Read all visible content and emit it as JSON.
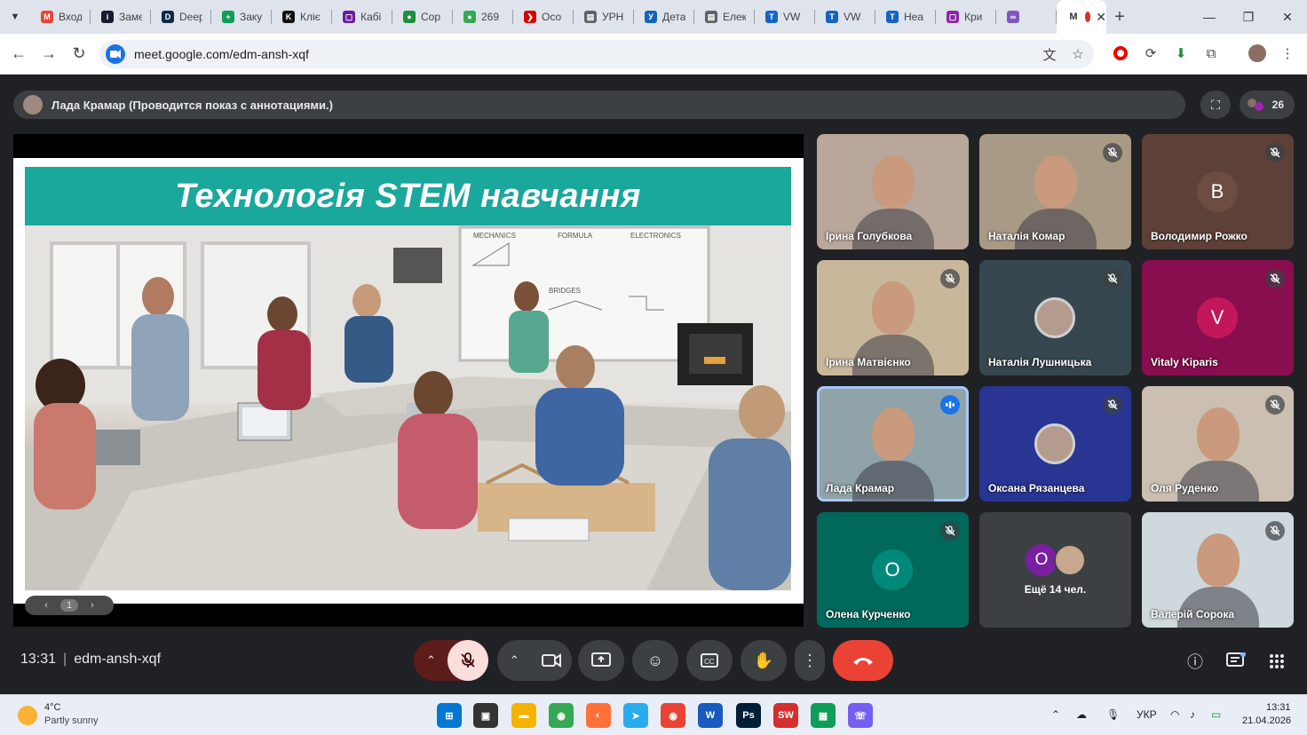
{
  "browser": {
    "tabs": [
      {
        "title": "Вход",
        "icon": "gmail-icon",
        "color": "#ea4335",
        "glyph": "M"
      },
      {
        "title": "Замет",
        "icon": "info-icon",
        "color": "#1a1a2e",
        "glyph": "i"
      },
      {
        "title": "DeepL",
        "icon": "deepl-icon",
        "color": "#0f2b46",
        "glyph": "D"
      },
      {
        "title": "Закупки",
        "icon": "sheets-icon",
        "color": "#0f9d58",
        "glyph": "+"
      },
      {
        "title": "Кліє",
        "icon": "k-icon",
        "color": "#111111",
        "glyph": "K"
      },
      {
        "title": "Кабі",
        "icon": "square-icon",
        "color": "#6a1b9a",
        "glyph": "▢"
      },
      {
        "title": "Сор",
        "icon": "green-circle-icon",
        "color": "#1e8e3e",
        "glyph": "●"
      },
      {
        "title": "269",
        "icon": "green-circle-icon",
        "color": "#34a853",
        "glyph": "●"
      },
      {
        "title": "Осо",
        "icon": "chevron-icon",
        "color": "#d50000",
        "glyph": "❯"
      },
      {
        "title": "УРН",
        "icon": "doc-icon",
        "color": "#5f6368",
        "glyph": "▤"
      },
      {
        "title": "Дета",
        "icon": "y-icon",
        "color": "#1565c0",
        "glyph": "У"
      },
      {
        "title": "Елек",
        "icon": "doc-icon",
        "color": "#5f6368",
        "glyph": "▤"
      },
      {
        "title": "VW",
        "icon": "t-icon",
        "color": "#1565c0",
        "glyph": "T"
      },
      {
        "title": "VW",
        "icon": "t-icon",
        "color": "#1565c0",
        "glyph": "T"
      },
      {
        "title": "Неа",
        "icon": "t-icon",
        "color": "#1565c0",
        "glyph": "T"
      },
      {
        "title": "Кри",
        "icon": "square-icon",
        "color": "#8e24aa",
        "glyph": "▢"
      },
      {
        "title": "",
        "icon": "crochet-icon",
        "color": "#7e57c2",
        "glyph": "∞"
      }
    ],
    "active_tab": {
      "title": "M",
      "icon": "record-icon"
    },
    "new_tab": "+",
    "url": "meet.google.com/edm-ansh-xqf"
  },
  "meet": {
    "presenter_label": "Лада Крамар (Проводится показ с аннотациями.)",
    "people_count": "26",
    "slide": {
      "title": "Технологія STEM навчання",
      "page": "1",
      "board": {
        "mechanics": "MECHANICS",
        "formula": "FORMULA",
        "electronics": "ELECTRONICS",
        "bridges": "BRIDGES"
      }
    },
    "participants": [
      {
        "name": "Ірина Голубкова",
        "type": "video",
        "muted": false,
        "bg": "#b8a79a"
      },
      {
        "name": "Наталія Комар",
        "type": "video",
        "muted": true,
        "bg": "#a99a86"
      },
      {
        "name": "Володимир Рожко",
        "type": "avatar",
        "initial": "B",
        "avatar_color": "#6d4c41",
        "muted": true,
        "bg": "#5d4037"
      },
      {
        "name": "Ірина Матвієнко",
        "type": "video",
        "muted": true,
        "bg": "#c9b79c"
      },
      {
        "name": "Наталія Лушницька",
        "type": "photo",
        "muted": true,
        "bg": "#37474f"
      },
      {
        "name": "Vitaly Kiparis",
        "type": "avatar",
        "initial": "V",
        "avatar_color": "#c2185b",
        "muted": true,
        "bg": "#880e4f"
      },
      {
        "name": "Лада Крамар",
        "type": "video",
        "muted": false,
        "speaking": true,
        "bg": "#8fa3a8"
      },
      {
        "name": "Оксана Рязанцева",
        "type": "photo",
        "muted": true,
        "bg": "#283593"
      },
      {
        "name": "Оля Руденко",
        "type": "video",
        "muted": true,
        "bg": "#cbbfb2"
      },
      {
        "name": "Олена Курченко",
        "type": "avatar",
        "initial": "O",
        "avatar_color": "#00897b",
        "muted": true,
        "bg": "#00695c"
      },
      {
        "name": "Ещё 14 чел.",
        "type": "more",
        "initial": "O",
        "avatar_color": "#7b1fa2",
        "muted": false,
        "bg": "#3c4043"
      },
      {
        "name": "Валерій Сорока",
        "type": "video",
        "muted": true,
        "bg": "#cfd8dc"
      }
    ],
    "clock": "13:31",
    "meeting_code": "edm-ansh-xqf"
  },
  "taskbar": {
    "weather_temp": "4°C",
    "weather_desc": "Partly sunny",
    "language": "УКР",
    "time": "13:31",
    "date": "21.04.2026",
    "apps": [
      {
        "name": "start-button",
        "glyph": "⊞",
        "color": "#0078d4"
      },
      {
        "name": "task-view-icon",
        "glyph": "▣",
        "color": "#333333"
      },
      {
        "name": "file-explorer-icon",
        "glyph": "▬",
        "color": "#f4b400"
      },
      {
        "name": "chrome-icon",
        "glyph": "◉",
        "color": "#34a853"
      },
      {
        "name": "firefox-icon",
        "glyph": "◐",
        "color": "#ff7139"
      },
      {
        "name": "telegram-icon",
        "glyph": "➤",
        "color": "#2aabee"
      },
      {
        "name": "chrome-profile-icon",
        "glyph": "◉",
        "color": "#ea4335"
      },
      {
        "name": "word-icon",
        "glyph": "W",
        "color": "#185abd"
      },
      {
        "name": "photoshop-icon",
        "glyph": "Ps",
        "color": "#001e36"
      },
      {
        "name": "sw-icon",
        "glyph": "SW",
        "color": "#d32f2f"
      },
      {
        "name": "sheets-app-icon",
        "glyph": "▦",
        "color": "#0f9d58"
      },
      {
        "name": "viber-icon",
        "glyph": "☏",
        "color": "#7360f2"
      }
    ]
  }
}
